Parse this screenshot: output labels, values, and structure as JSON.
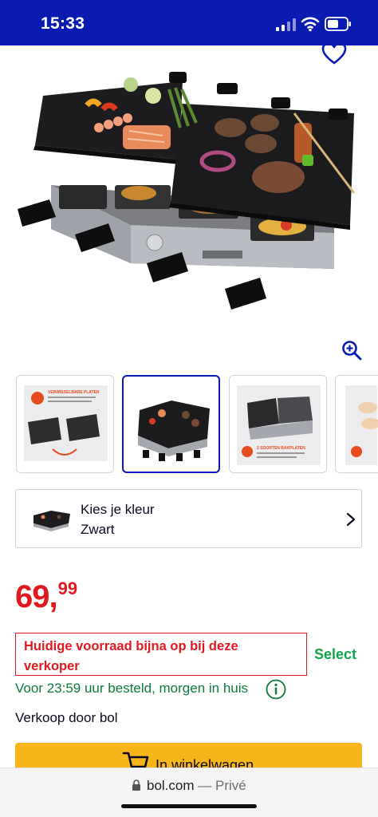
{
  "status_bar": {
    "time": "15:33",
    "icons": [
      "signal-icon",
      "wifi-icon",
      "battery-icon"
    ]
  },
  "header": {
    "favorite_icon": "heart-icon"
  },
  "product": {
    "image_alt": "Raclette grill",
    "thumbnail_1_text_line1": "VERWISSELBARE PLATEN",
    "thumbnail_3_text_line1": "2 SOORTEN BAKPLATEN"
  },
  "zoom_icon": "zoom-in-icon",
  "color_selector": {
    "label": "Kies je kleur",
    "value": "Zwart",
    "icon": "chevron-right-icon"
  },
  "price": {
    "whole": "69,",
    "decimals": "99"
  },
  "stock_notice": {
    "line1": "Huidige voorraad bijna op bij deze",
    "line2": "verkoper"
  },
  "select_label": "Select",
  "delivery": {
    "text": "Voor 23:59 uur besteld, morgen in huis",
    "icon": "info-icon"
  },
  "seller": {
    "text": "Verkoop door bol"
  },
  "cart_button": {
    "label": "In winkelwagen",
    "icon": "cart-icon"
  },
  "browser": {
    "domain": "bol.com",
    "separator": " — ",
    "mode": "Privé",
    "icon": "lock-icon"
  },
  "colors": {
    "brand_blue": "#0a1bb2",
    "price_red": "#e0191f",
    "success_green": "#10a34b",
    "cart_yellow": "#f8b51a"
  }
}
